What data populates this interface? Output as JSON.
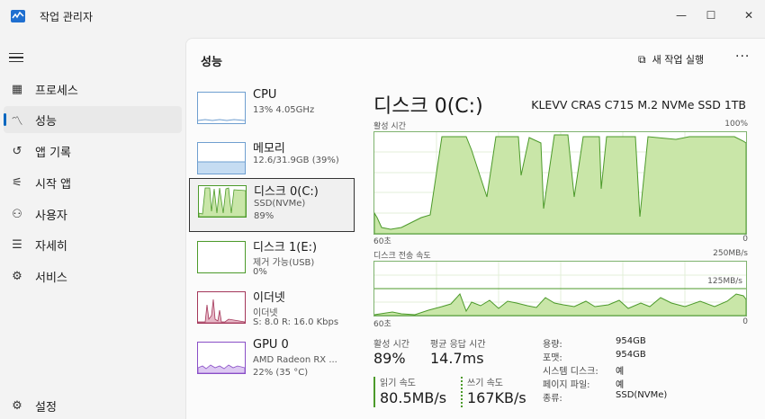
{
  "window": {
    "title": "작업 관리자",
    "minimize": "—",
    "maximize": "☐",
    "close": "✕"
  },
  "nav": {
    "items": [
      {
        "label": "프로세스",
        "icon": "processes-icon"
      },
      {
        "label": "성능",
        "icon": "performance-icon",
        "active": true
      },
      {
        "label": "앱 기록",
        "icon": "history-icon"
      },
      {
        "label": "시작 앱",
        "icon": "startup-icon"
      },
      {
        "label": "사용자",
        "icon": "users-icon"
      },
      {
        "label": "자세히",
        "icon": "details-icon"
      },
      {
        "label": "서비스",
        "icon": "services-icon"
      }
    ],
    "settings_label": "설정"
  },
  "header": {
    "title": "성능",
    "run_task_label": "새 작업 실행",
    "more_label": "···"
  },
  "devices": [
    {
      "name": "CPU",
      "sub1": "13% 4.05GHz",
      "sub2": "",
      "sub3": ""
    },
    {
      "name": "메모리",
      "sub1": "12.6/31.9GB (39%)",
      "sub2": "",
      "sub3": ""
    },
    {
      "name": "디스크 0(C:)",
      "sub1": "SSD(NVMe)",
      "sub2": "89%",
      "sub3": ""
    },
    {
      "name": "디스크 1(E:)",
      "sub1": "제거 가능(USB)",
      "sub2": "0%",
      "sub3": ""
    },
    {
      "name": "이더넷",
      "sub1": "이더넷",
      "sub2": "S: 8.0  R: 16.0 Kbps",
      "sub3": ""
    },
    {
      "name": "GPU 0",
      "sub1": "AMD Radeon RX ...",
      "sub2": "22% (35 °C)",
      "sub3": ""
    }
  ],
  "detail": {
    "title": "디스크 0(C:)",
    "model": "KLEVV CRAS C715 M.2 NVMe SSD 1TB",
    "active_time_label": "활성 시간",
    "active_time_max": "100%",
    "axis_left": "60초",
    "axis_right": "0",
    "transfer_label": "디스크 전송 속도",
    "transfer_max": "250MB/s",
    "transfer_mid": "125MB/s",
    "stats": {
      "active_label": "활성 시간",
      "active_value": "89%",
      "resp_label": "평균 응답 시간",
      "resp_value": "14.7ms",
      "read_label": "읽기 속도",
      "read_value": "80.5MB/s",
      "write_label": "쓰기 속도",
      "write_value": "167KB/s"
    },
    "props": [
      {
        "k": "용량:",
        "v": "954GB"
      },
      {
        "k": "포맷:",
        "v": "954GB"
      },
      {
        "k": "시스템 디스크:",
        "v": "예"
      },
      {
        "k": "페이지 파일:",
        "v": "예"
      },
      {
        "k": "종류:",
        "v": "SSD(NVMe)"
      }
    ]
  },
  "colors": {
    "accent": "#0067c0",
    "disk_line": "#4c9a2a",
    "disk_fill": "#c9e6a8",
    "cpu": "#6f9fd0",
    "ethernet": "#a4375a",
    "gpu": "#8a4fc7"
  }
}
